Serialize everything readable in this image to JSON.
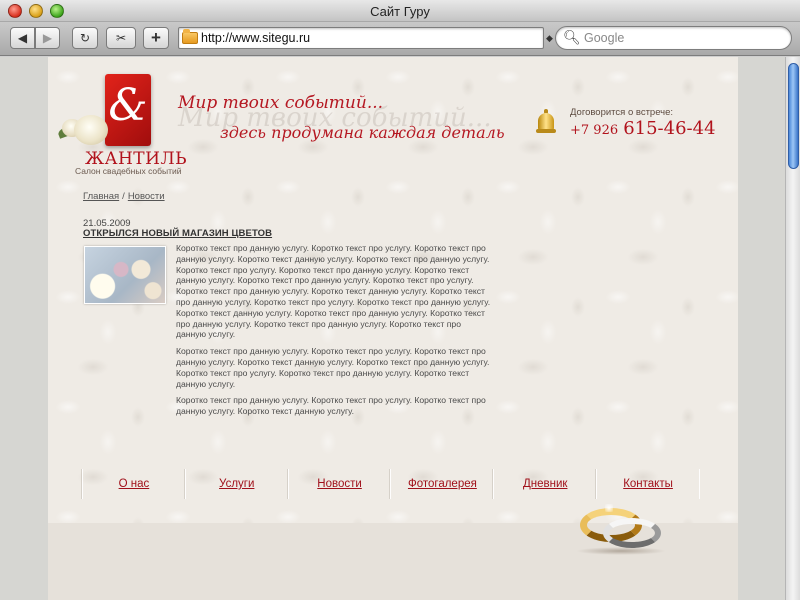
{
  "window": {
    "title": "Сайт Гуру"
  },
  "toolbar": {
    "back_icon": "◀",
    "forward_icon": "▶",
    "reload_icon": "↻",
    "snap_icon": "✂",
    "add_icon": "+",
    "address": "http://www.sitegu.ru",
    "search_placeholder": "Google",
    "search_icon": "🔍︎"
  },
  "header": {
    "logo_glyph": "&",
    "brand_name": "ЖАНТИЛЬ",
    "brand_tagline": "Салон свадебных событий",
    "slogan_line1": "Мир твоих событий...",
    "slogan_line2": "здесь продумана каждая деталь",
    "contact_label": "Договорится о встрече:",
    "phone_prefix": "+7 926",
    "phone_number": "615-46-44"
  },
  "breadcrumb": {
    "home": "Главная",
    "separator": "/",
    "current": "Новости"
  },
  "article": {
    "date": "21.05.2009",
    "title": "Открылся новый магазин цветов",
    "paragraphs": [
      "Коротко текст про данную услугу.  Коротко текст про услугу. Коротко текст про данную услугу.  Коротко текст данную услугу. Коротко текст про данную услугу.  Коротко текст про услугу. Коротко текст про данную услугу. Коротко текст данную услугу. Коротко текст про данную услугу.  Коротко текст про услугу. Коротко текст про данную услугу.  Коротко текст данную услугу. Коротко текст про данную услугу.  Коротко текст про услугу. Коротко текст про данную услугу.  Коротко текст данную услугу. Коротко текст про данную услугу.  Коротко текст про данную услугу.  Коротко текст про данную услугу.  Коротко текст про данную услугу.",
      "Коротко текст про данную услугу.  Коротко текст про услугу. Коротко текст про данную услугу.  Коротко текст данную услугу. Коротко текст про данную услугу.  Коротко текст про услугу. Коротко текст про данную услугу.  Коротко текст данную услугу.",
      "Коротко текст про данную услугу.  Коротко текст про услугу. Коротко текст про данную услугу.  Коротко текст данную услугу."
    ]
  },
  "nav": [
    {
      "label": "О нас"
    },
    {
      "label": "Услуги"
    },
    {
      "label": "Новости"
    },
    {
      "label": "Фотогалерея"
    },
    {
      "label": "Дневник"
    },
    {
      "label": "Контакты"
    }
  ],
  "colors": {
    "brand_red": "#b1121c",
    "link_red": "#a0101a",
    "page_bg": "#efebe5"
  }
}
